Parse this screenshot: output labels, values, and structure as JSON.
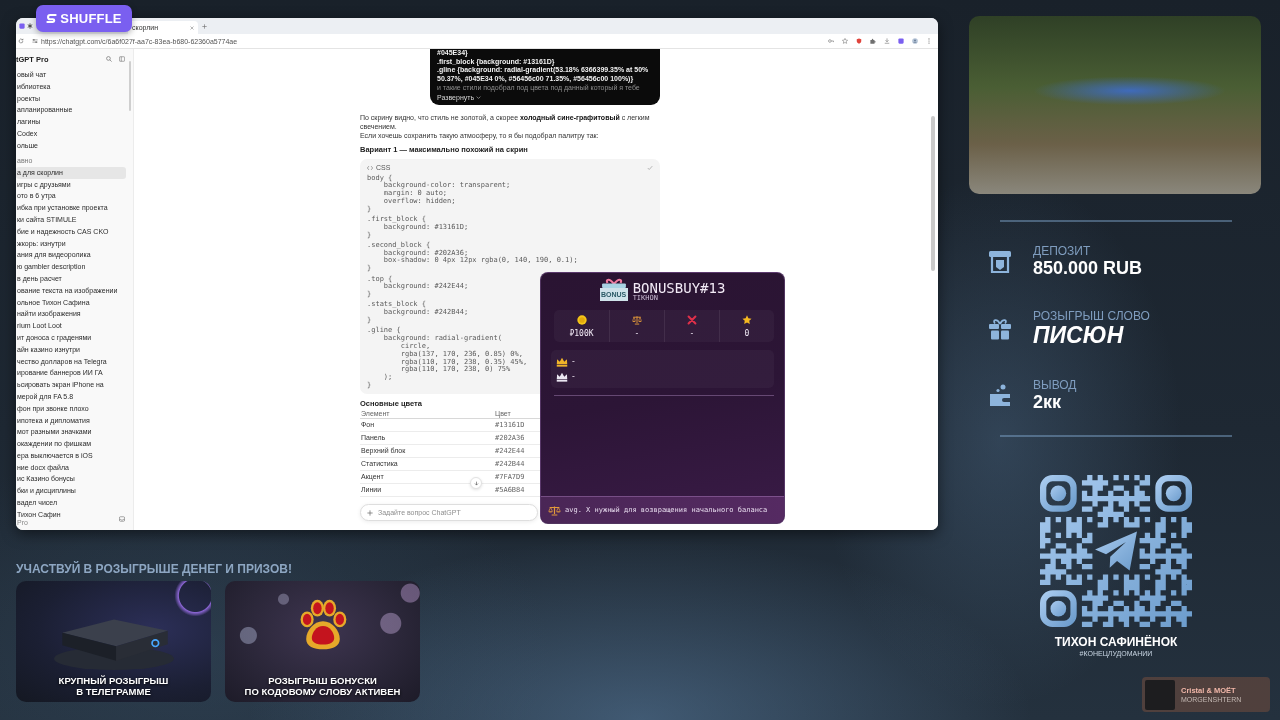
{
  "logo": {
    "text": "SHUFFLE"
  },
  "browser": {
    "tabs": [
      {
        "title": "скорлин",
        "selected": true
      }
    ],
    "url": "https://chatgpt.com/c/6a6f027f-aa7c-83ea-b680-62360a5774ae",
    "sidebar": {
      "title": "tGPT Pro",
      "nav": [
        "овый чат",
        "иблиотека",
        "роекты",
        "апланированные",
        "лагины",
        "Codex",
        "ольше"
      ],
      "section": "авно",
      "chats": [
        {
          "title": "а для скорлин",
          "selected": true
        },
        {
          "title": "игры с друзьями",
          "selected": false
        },
        {
          "title": "ото в 6 утра",
          "selected": false
        },
        {
          "title": "ибка при установке проекта",
          "selected": false
        },
        {
          "title": "ки сайта STIMULE",
          "selected": false
        },
        {
          "title": "бие и надежность CAS CKO",
          "selected": false
        },
        {
          "title": "жкорь: изнутри",
          "selected": false
        },
        {
          "title": "ания для видеоролика",
          "selected": false
        },
        {
          "title": "ю gambler description",
          "selected": false
        },
        {
          "title": "в день расчет",
          "selected": false
        },
        {
          "title": "ование текста на изображении",
          "selected": false
        },
        {
          "title": "ольное Тихон Сафина",
          "selected": false
        },
        {
          "title": "найти изображения",
          "selected": false
        },
        {
          "title": "rium Loot Loot",
          "selected": false
        },
        {
          "title": "ит доноса с граденями",
          "selected": false
        },
        {
          "title": "айн казино изнутри",
          "selected": false
        },
        {
          "title": "чество долларов на Telegra",
          "selected": false
        },
        {
          "title": "ирование баннеров ИИ ГА",
          "selected": false
        },
        {
          "title": "ьсировать экран iPhone на",
          "selected": false
        },
        {
          "title": "мерой для FA 5.8",
          "selected": false
        },
        {
          "title": "фон при звонке плохо",
          "selected": false
        },
        {
          "title": "ипотека и дипломатия",
          "selected": false
        },
        {
          "title": "мот разными значками",
          "selected": false
        },
        {
          "title": "окаждении по фишкам",
          "selected": false
        },
        {
          "title": "ера выключается в iOS",
          "selected": false
        },
        {
          "title": "ние docx файла",
          "selected": false
        },
        {
          "title": "ис Казино бонусы",
          "selected": false
        },
        {
          "title": "бки и дисциплины",
          "selected": false
        },
        {
          "title": "вадел чисел",
          "selected": false
        }
      ],
      "user": {
        "name": "Тихон Сафин",
        "plan": "Pro"
      }
    },
    "chat": {
      "message_preview": {
        "lines": [
          "#045E34}",
          ".first_block {background: #13161D}",
          ".gline {background: radial-gradient(53.18% 6366399.35% at 50% 50.37%, #045E34 0%, #56456c00 71.35%, #56456c00 100%)}"
        ],
        "faded_line": "и такие стили подобрал под цвета под данный который я тебе",
        "expand": "Развернуть"
      },
      "paragraph": "По скрину видно, что стиль не золотой, а скорее **холодный сине-графитовый** с легким свечением.\nЕсли хочешь сохранить такую атмосферу, то я бы подобрал палитру так:",
      "heading": "Вариант 1 — максимально похожий на скрин",
      "code_block": {
        "language": "CSS",
        "rules": [
          [
            "body {",
            "    background-color: transparent;",
            "    margin: 0 auto;",
            "    overflow: hidden;",
            "}"
          ],
          [
            ".first_block {",
            "    background: #13161D;",
            "}"
          ],
          [
            ".second_block {",
            "    background: #202A36;",
            "    box-shadow: 0 4px 12px rgba(0, 140, 190, 0.1);",
            "}"
          ],
          [
            ".top {",
            "    background: #242E44;",
            "}"
          ],
          [
            ".stats_block {",
            "    background: #242B44;",
            "}"
          ],
          [
            ".gline {",
            "    background: radial-gradient(",
            "        circle,",
            "        rgba(137, 170, 236, 0.85) 0%,",
            "        rgba(110, 170, 238, 0.35) 45%,",
            "        rgba(110, 170, 238, 0) 75%",
            "    );",
            "}"
          ]
        ]
      },
      "colors_heading": "Основные цвета",
      "table": {
        "columns": [
          "Элемент",
          "Цвет"
        ],
        "rows": [
          [
            "Фон",
            "#13161D"
          ],
          [
            "Панель",
            "#202A36"
          ],
          [
            "Верхний блок",
            "#242E44"
          ],
          [
            "Статистика",
            "#242B44"
          ],
          [
            "Акцент",
            "#7FA7D9"
          ],
          [
            "Линии",
            "#5A6B84"
          ]
        ]
      },
      "composer": {
        "placeholder": "Задайте вопрос ChatGPT"
      }
    }
  },
  "bonus_widget": {
    "box_label": "BONUS",
    "title": "BONUSBUY#13",
    "subtitle": "TIKHON",
    "stats": [
      {
        "kind": "coin",
        "value": "₽100K"
      },
      {
        "kind": "scales",
        "value": "-"
      },
      {
        "kind": "cross",
        "value": "-"
      },
      {
        "kind": "star",
        "value": "0"
      }
    ],
    "leaders": [
      {
        "kind": "gold",
        "value": "-"
      },
      {
        "kind": "silver",
        "value": "-"
      }
    ],
    "footer": "avg. X нужный для возвращения начального баланса"
  },
  "promo": {
    "heading": "УЧАСТВУЙ В РОЗЫГРЫШЕ ДЕНЕГ И ПРИЗОВ!",
    "cards": [
      {
        "kind": "console",
        "caption": "КРУПНЫЙ РОЗЫГРЫШ\nВ ТЕЛЕГРАММЕ"
      },
      {
        "kind": "paw",
        "caption": "РОЗЫГРЫШ БОНУСКИ\nПО КОДОВОМУ СЛОВУ АКТИВЕН"
      }
    ]
  },
  "side_panel": {
    "stats": [
      {
        "kind": "deposit",
        "label": "ДЕПОЗИТ",
        "value": "850.000 RUB"
      },
      {
        "kind": "giveaway",
        "label": "РОЗЫГРЫШ СЛОВО",
        "value": "ПИСЮН"
      },
      {
        "kind": "withdrawal",
        "label": "ВЫВОД",
        "value": "2кк"
      }
    ],
    "streamer": {
      "name": "ТИХОН САФИНЁНОК",
      "hashtag": "#КОНЕЦЛУДОМАНИИ"
    }
  },
  "now_playing": {
    "title": "Cristal & МОЁТ",
    "artist": "MORGENSHTERN"
  }
}
